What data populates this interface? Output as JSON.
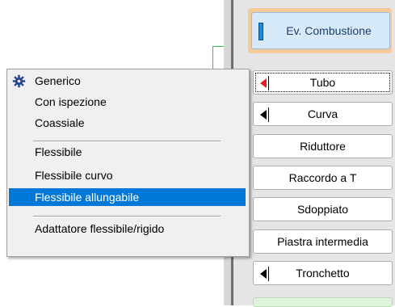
{
  "side_panel": {
    "combustione_label": "Ev. Combustione",
    "buttons": [
      {
        "label": "Tubo",
        "icon": "red-left-arrow-icon"
      },
      {
        "label": "Curva",
        "icon": "left-arrow-icon"
      },
      {
        "label": "Riduttore"
      },
      {
        "label": "Raccordo a T"
      },
      {
        "label": "Sdoppiato"
      },
      {
        "label": "Piastra intermedia"
      },
      {
        "label": "Tronchetto",
        "icon": "left-arrow-icon"
      }
    ]
  },
  "context_menu": {
    "items": [
      {
        "label": "Generico",
        "icon": "gear-icon"
      },
      {
        "label": "Con ispezione"
      },
      {
        "label": "Coassiale"
      },
      {
        "label": "Flessibile"
      },
      {
        "label": "Flessibile curvo"
      },
      {
        "label": "Flessibile allungabile",
        "highlighted": true
      },
      {
        "label": "Adattatore flessibile/rigido"
      }
    ]
  },
  "colors": {
    "highlight": "#0078d7",
    "accent_orange": "#f6c99a",
    "active_arrow": "#e31e1e"
  }
}
